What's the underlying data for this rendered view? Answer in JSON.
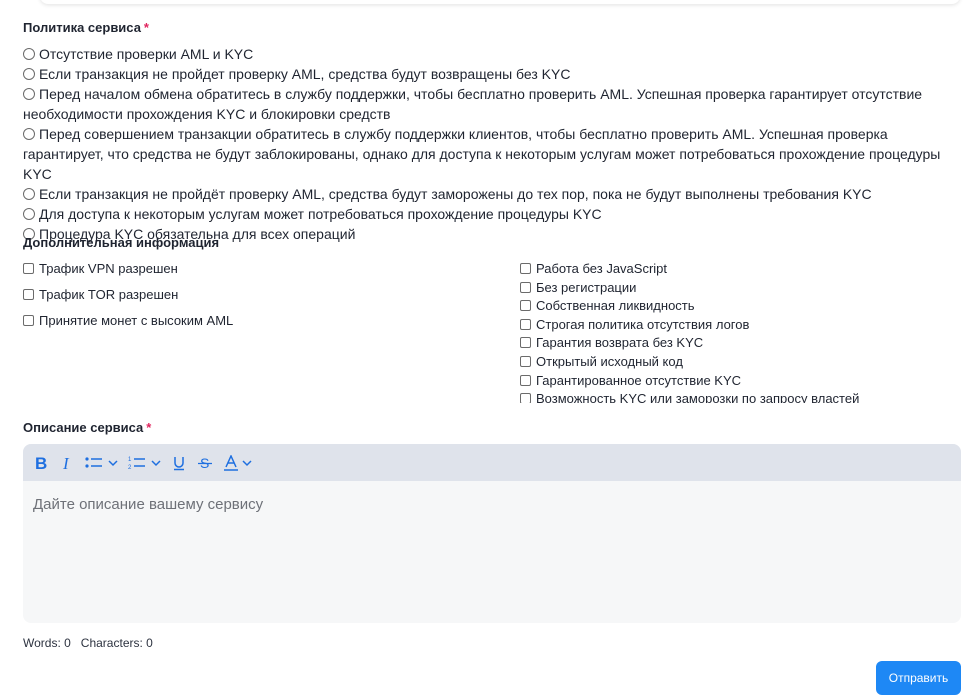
{
  "policy": {
    "title": "Политика сервиса",
    "required_mark": "*",
    "options": [
      "Отсутствие проверки AML и KYC",
      "Если транзакция не пройдет проверку AML, средства будут возвращены без KYC",
      "Перед началом обмена обратитесь в службу поддержки, чтобы бесплатно проверить AML. Успешная проверка гарантирует отсутствие необходимости прохождения KYC и блокировки средств",
      "Перед совершением транзакции обратитесь в службу поддержки клиентов, чтобы бесплатно проверить AML. Успешная проверка гарантирует, что средства не будут заблокированы, однако для доступа к некоторым услугам может потребоваться прохождение процедуры KYC",
      "Если транзакция не пройдёт проверку AML, средства будут заморожены до тех пор, пока не будут выполнены требования KYC",
      "Для доступа к некоторым услугам может потребоваться прохождение процедуры KYC",
      "Процедура KYC обязательна для всех операций"
    ]
  },
  "extra": {
    "title": "Дополнительная информация",
    "left": [
      "Трафик VPN разрешен",
      "Трафик TOR разрешен",
      "Принятие монет с высоким AML"
    ],
    "right": [
      "Работа без JavaScript",
      "Без регистрации",
      "Собственная ликвидность",
      "Строгая политика отсутствия логов",
      "Гарантия возврата без KYC",
      "Открытый исходный код",
      "Гарантированное отсутствие KYC",
      "Возможность KYC или заморозки по запросу властей"
    ]
  },
  "description": {
    "title": "Описание сервиса",
    "required_mark": "*",
    "placeholder": "Дайте описание вашему сервису",
    "toolbar": [
      "bold-icon",
      "italic-icon",
      "bullet-list-icon",
      "numbered-list-icon",
      "underline-icon",
      "strikethrough-icon",
      "text-color-icon"
    ],
    "words_label": "Words: 0",
    "chars_label": "Characters: 0"
  },
  "submit_label": "Отправить",
  "colors": {
    "accent": "#1e88f5",
    "toolbar_bg": "#dfe3eb",
    "required": "#e0245e"
  }
}
